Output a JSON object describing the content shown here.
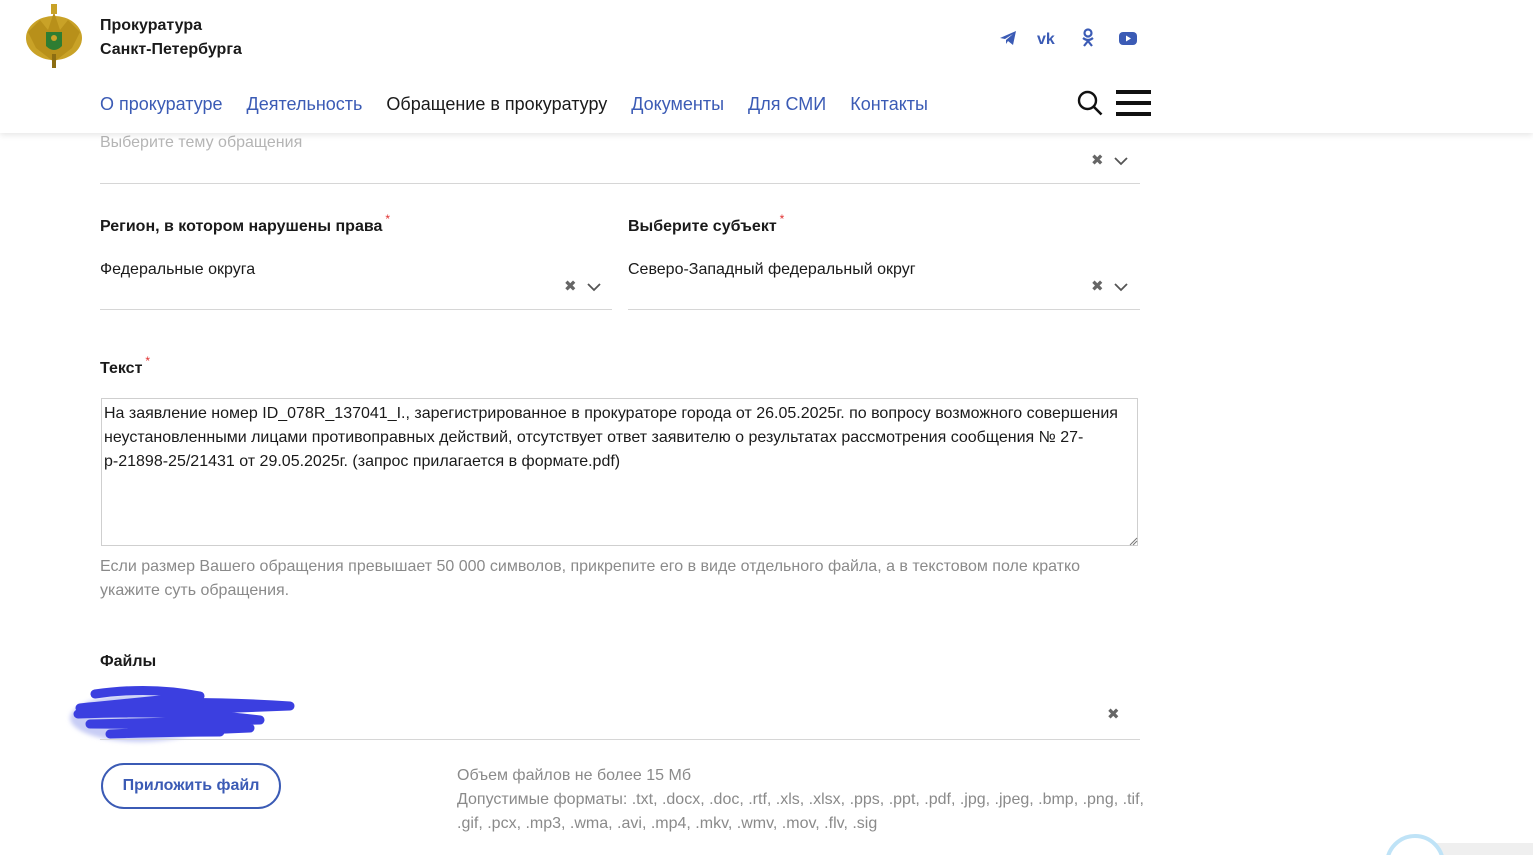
{
  "header": {
    "org_line1": "Прокуратура",
    "org_line2": "Санкт-Петербурга",
    "social": [
      "telegram-icon",
      "vk-icon",
      "odnoklassniki-icon",
      "youtube-icon"
    ],
    "accent_color": "#3b5bb5"
  },
  "nav": {
    "items": [
      {
        "label": "О прокуратуре"
      },
      {
        "label": "Деятельность"
      },
      {
        "label": "Обращение в прокуратуру"
      },
      {
        "label": "Документы"
      },
      {
        "label": "Для СМИ"
      },
      {
        "label": "Контакты"
      }
    ],
    "active_index": 2
  },
  "form": {
    "topic": {
      "placeholder": "Выберите тему обращения"
    },
    "region": {
      "label": "Регион, в котором нарушены права",
      "required_mark": "*",
      "value": "Федеральные округа"
    },
    "subject": {
      "label": "Выберите субъект",
      "required_mark": "*",
      "value": "Северо-Западный федеральный округ"
    },
    "text": {
      "label": "Текст",
      "required_mark": "*",
      "value": "На заявление номер ID_078R_137041_I., зарегистрированное в прокураторе города от 26.05.2025г. по вопросу возможного совершения неустановленными лицами противоправных действий, отсутствует ответ заявителю о результатах рассмотрения сообщения № 27-р-21898-25/21431 от 29.05.2025г. (запрос прилагается в формате.pdf)",
      "hint": "Если размер Вашего обращения превышает 50 000 символов, прикрепите его в виде отдельного файла, а в текстовом поле кратко укажите суть обращения."
    },
    "files": {
      "label": "Файлы",
      "attach_button": "Приложить файл",
      "size_limit": "Объем файлов не более 15 Мб",
      "formats": "Допустимые форматы: .txt, .docx, .doc, .rtf, .xls, .xlsx, .pps, .ppt, .pdf, .jpg, .jpeg, .bmp, .png, .tif, .gif, .pcx, .mp3, .wma, .avi, .mp4, .mkv, .wmv, .mov, .flv, .sig"
    },
    "clear_symbol": "✖"
  }
}
